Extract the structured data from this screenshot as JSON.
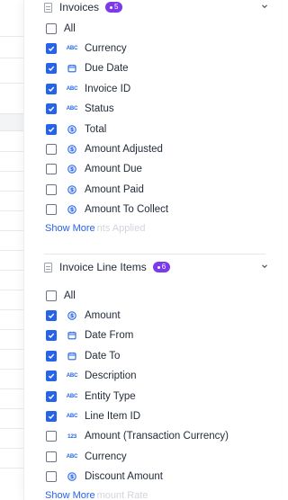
{
  "sections": [
    {
      "title": "Invoices",
      "badge": "5",
      "all_label": "All",
      "items": [
        {
          "label": "Currency",
          "type": "text-type-icon",
          "checked": true
        },
        {
          "label": "Due Date",
          "type": "calendar-icon",
          "checked": true
        },
        {
          "label": "Invoice ID",
          "type": "text-type-icon",
          "checked": true
        },
        {
          "label": "Status",
          "type": "text-type-icon",
          "checked": true
        },
        {
          "label": "Total",
          "type": "currency-icon",
          "checked": true
        },
        {
          "label": "Amount Adjusted",
          "type": "currency-icon",
          "checked": false
        },
        {
          "label": "Amount Due",
          "type": "currency-icon",
          "checked": false
        },
        {
          "label": "Amount Paid",
          "type": "currency-icon",
          "checked": false
        },
        {
          "label": "Amount To Collect",
          "type": "currency-icon",
          "checked": false
        }
      ],
      "show_more": "Show More",
      "ghost_text": "nts Applied"
    },
    {
      "title": "Invoice Line Items",
      "badge": "6",
      "all_label": "All",
      "items": [
        {
          "label": "Amount",
          "type": "currency-icon",
          "checked": true
        },
        {
          "label": "Date From",
          "type": "calendar-icon",
          "checked": true
        },
        {
          "label": "Date To",
          "type": "calendar-icon",
          "checked": true
        },
        {
          "label": "Description",
          "type": "text-type-icon",
          "checked": true
        },
        {
          "label": "Entity Type",
          "type": "text-type-icon",
          "checked": true
        },
        {
          "label": "Line Item ID",
          "type": "text-type-icon",
          "checked": true
        },
        {
          "label": "Amount (Transaction Currency)",
          "type": "number-type-icon",
          "checked": false
        },
        {
          "label": "Currency",
          "type": "text-type-icon",
          "checked": false
        },
        {
          "label": "Discount Amount",
          "type": "currency-icon",
          "checked": false
        }
      ],
      "show_more": "Show More",
      "ghost_text": "mount Rate"
    }
  ],
  "icons": {
    "text": "ABC",
    "number": "123"
  },
  "colors": {
    "accent": "#2563eb",
    "badge": "#7c3aed",
    "text": "#1f2937"
  }
}
